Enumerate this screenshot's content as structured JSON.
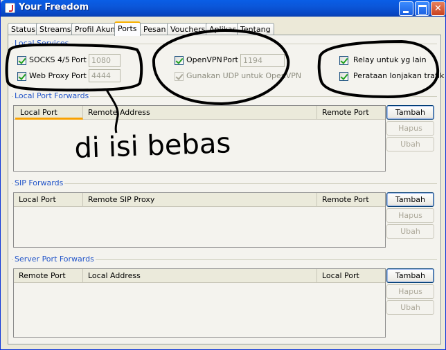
{
  "window": {
    "title": "Your Freedom"
  },
  "tabs": [
    {
      "label": "Status"
    },
    {
      "label": "Streams"
    },
    {
      "label": "Profil Akun"
    },
    {
      "label": "Ports",
      "active": true
    },
    {
      "label": "Pesan"
    },
    {
      "label": "Vouchers"
    },
    {
      "label": "Aplikasi"
    },
    {
      "label": "Tentang"
    }
  ],
  "local_services": {
    "title": "Local Services",
    "socks": {
      "label": "SOCKS 4/5",
      "port_label": "Port",
      "port": "1080",
      "checked": true
    },
    "web_proxy": {
      "label": "Web Proxy",
      "port_label": "Port",
      "port": "4444",
      "checked": true
    },
    "openvpn": {
      "label": "OpenVPN",
      "port_label": "Port",
      "port": "1194",
      "checked": true
    },
    "udp": {
      "label": "Gunakan UDP untuk OpenVPN",
      "checked": true,
      "enabled": false
    },
    "relay": {
      "label": "Relay untuk yg lain",
      "checked": true
    },
    "shaping": {
      "label": "Perataan lonjakan trafik",
      "checked": true
    }
  },
  "local_port_forwards": {
    "title": "Local Port Forwards",
    "columns": [
      "Local Port",
      "Remote Address",
      "Remote Port"
    ],
    "rows": [],
    "buttons": {
      "add": "Tambah",
      "remove": "Hapus",
      "edit": "Ubah"
    }
  },
  "sip_forwards": {
    "title": "SIP Forwards",
    "columns": [
      "Local Port",
      "Remote SIP Proxy",
      "Remote Port"
    ],
    "rows": [],
    "buttons": {
      "add": "Tambah",
      "remove": "Hapus",
      "edit": "Ubah"
    }
  },
  "server_port_forwards": {
    "title": "Server Port Forwards",
    "columns": [
      "Remote Port",
      "Local Address",
      "Local Port"
    ],
    "rows": [],
    "buttons": {
      "add": "Tambah",
      "remove": "Hapus",
      "edit": "Ubah"
    }
  },
  "annotation": {
    "text": "di isi bebas"
  }
}
